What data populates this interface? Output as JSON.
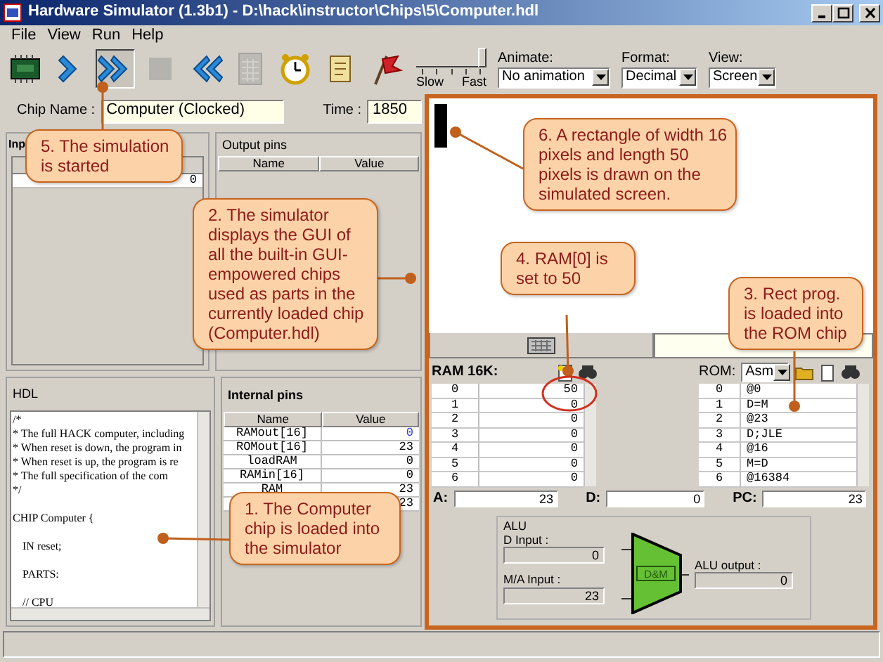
{
  "window": {
    "title": "Hardware Simulator (1.3b1) - D:\\hack\\instructor\\Chips\\5\\Computer.hdl"
  },
  "menu": [
    "File",
    "View",
    "Run",
    "Help"
  ],
  "toolbar": [
    {
      "kind": "chip",
      "disabled": false,
      "pressed": false
    },
    {
      "kind": "step",
      "disabled": false,
      "pressed": false
    },
    {
      "kind": "run",
      "disabled": false,
      "pressed": true
    },
    {
      "kind": "stop",
      "disabled": true,
      "pressed": false
    },
    {
      "kind": "reset",
      "disabled": false,
      "pressed": false
    },
    {
      "kind": "script",
      "disabled": true,
      "pressed": false
    },
    {
      "kind": "clock",
      "disabled": false,
      "pressed": false
    },
    {
      "kind": "scroll",
      "disabled": false,
      "pressed": false
    },
    {
      "kind": "flag",
      "disabled": false,
      "pressed": false
    }
  ],
  "speed": {
    "level": 1,
    "min_label": "Slow",
    "max_label": "Fast"
  },
  "dropdowns": [
    {
      "label": "Animate:",
      "value": "No animation"
    },
    {
      "label": "Format:",
      "value": "Decimal"
    },
    {
      "label": "View:",
      "value": "Screen"
    }
  ],
  "chip": {
    "label": "Chip Name :",
    "value": "Computer (Clocked)"
  },
  "time": {
    "label": "Time :",
    "value": "1850"
  },
  "input_pins": {
    "title": "Inp",
    "rows": [
      {
        "value": "0"
      }
    ]
  },
  "output_pins": {
    "title": "Output pins",
    "columns": [
      "Name",
      "Value"
    ]
  },
  "hdl": {
    "title": "HDL",
    "lines": [
      {
        "text": "/*",
        "space_before": false,
        "indented": false
      },
      {
        "text": "* The full HACK computer, including",
        "space_before": false,
        "indented": false
      },
      {
        "text": "* When reset is down, the program in",
        "space_before": false,
        "indented": false
      },
      {
        "text": "* When reset is up, the program is re",
        "space_before": false,
        "indented": false
      },
      {
        "text": "* The full specification of the com",
        "space_before": false,
        "indented": false
      },
      {
        "text": "*/",
        "space_before": false,
        "indented": false
      },
      {
        "text": "CHIP Computer {",
        "space_before": true,
        "indented": false
      },
      {
        "text": "IN reset;",
        "space_before": true,
        "indented": true
      },
      {
        "text": "PARTS:",
        "space_before": true,
        "indented": true
      },
      {
        "text": "// CPU",
        "space_before": true,
        "indented": true
      }
    ]
  },
  "internal_pins": {
    "title": "Internal pins",
    "columns": [
      "Name",
      "Value"
    ],
    "rows": [
      {
        "name": "RAMout[16]",
        "value": "0",
        "changed": true
      },
      {
        "name": "ROMout[16]",
        "value": "23",
        "changed": false
      },
      {
        "name": "loadRAM",
        "value": "0",
        "changed": false
      },
      {
        "name": "RAMin[16]",
        "value": "0",
        "changed": false
      },
      {
        "name": "RAM",
        "value": "23",
        "changed": false
      },
      {
        "name": "",
        "value": "23",
        "changed": false
      }
    ]
  },
  "ram": {
    "title": "RAM 16K:",
    "rows": [
      [
        "0",
        "50"
      ],
      [
        "1",
        "0"
      ],
      [
        "2",
        "0"
      ],
      [
        "3",
        "0"
      ],
      [
        "4",
        "0"
      ],
      [
        "5",
        "0"
      ],
      [
        "6",
        "0"
      ]
    ]
  },
  "rom": {
    "label": "ROM:",
    "format": "Asm",
    "rows": [
      [
        "0",
        "@0"
      ],
      [
        "1",
        "D=M"
      ],
      [
        "2",
        "@23"
      ],
      [
        "3",
        "D;JLE"
      ],
      [
        "4",
        "@16"
      ],
      [
        "5",
        "M=D"
      ],
      [
        "6",
        "@16384"
      ]
    ]
  },
  "registers": [
    {
      "label": "A:",
      "value": "23"
    },
    {
      "label": "D:",
      "value": "0"
    },
    {
      "label": "PC:",
      "value": "23"
    }
  ],
  "alu": {
    "title": "ALU",
    "d_input_label": "D Input :",
    "d_input": "0",
    "ma_input_label": "M/A Input :",
    "ma_input": "23",
    "function": "D&M",
    "output_label": "ALU output :",
    "output": "0"
  },
  "callouts": [
    "5. The simulation is started",
    "6. A rectangle of width 16 pixels and length 50 pixels is drawn on the simulated screen.",
    "2. The simulator displays the GUI of all the built-in GUI-empowered chips used as parts in the currently  loaded chip (Computer.hdl)",
    "4. RAM[0] is set to 50",
    "3. Rect prog. is loaded into the ROM chip",
    "1. The Computer chip is loaded into the simulator"
  ]
}
